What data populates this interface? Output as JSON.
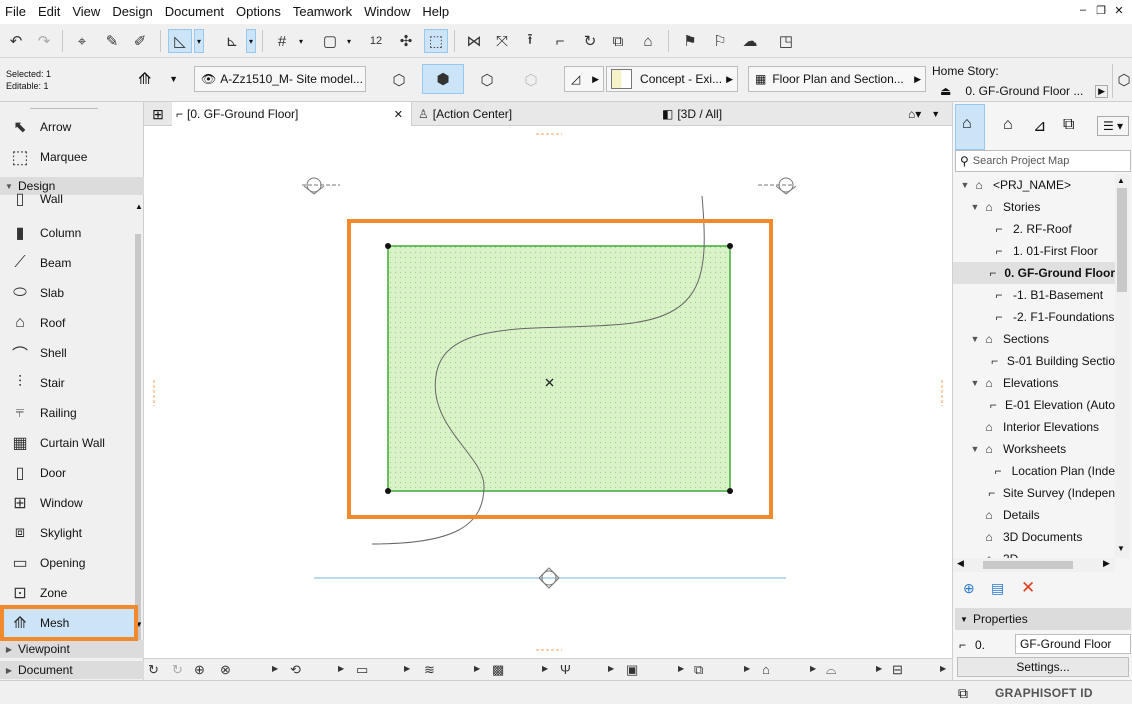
{
  "menu": [
    "File",
    "Edit",
    "View",
    "Design",
    "Document",
    "Options",
    "Teamwork",
    "Window",
    "Help"
  ],
  "window_controls": [
    "–",
    "❐",
    "✕"
  ],
  "info": {
    "selected": "Selected: 1",
    "editable": "Editable: 1"
  },
  "infobox": {
    "layer": "A-Zz1510_M- Site model...",
    "surface": "Concept - Exi...",
    "floor_plan": "Floor Plan and Section...",
    "home_story_label": "Home Story:",
    "home_story_value": "0. GF-Ground Floor ..."
  },
  "toolbox": {
    "pointer_tools": [
      {
        "label": "Arrow",
        "icon": "arrow-icon"
      },
      {
        "label": "Marquee",
        "icon": "marquee-icon"
      }
    ],
    "design_header": "Design",
    "design_tools": [
      {
        "label": "Wall",
        "icon": "wall-icon"
      },
      {
        "label": "Column",
        "icon": "column-icon"
      },
      {
        "label": "Beam",
        "icon": "beam-icon"
      },
      {
        "label": "Slab",
        "icon": "slab-icon"
      },
      {
        "label": "Roof",
        "icon": "roof-icon"
      },
      {
        "label": "Shell",
        "icon": "shell-icon"
      },
      {
        "label": "Stair",
        "icon": "stair-icon"
      },
      {
        "label": "Railing",
        "icon": "railing-icon"
      },
      {
        "label": "Curtain Wall",
        "icon": "curtain-wall-icon"
      },
      {
        "label": "Door",
        "icon": "door-icon"
      },
      {
        "label": "Window",
        "icon": "window-icon"
      },
      {
        "label": "Skylight",
        "icon": "skylight-icon"
      },
      {
        "label": "Opening",
        "icon": "opening-icon"
      },
      {
        "label": "Zone",
        "icon": "zone-icon"
      },
      {
        "label": "Mesh",
        "icon": "mesh-icon",
        "selected": true
      }
    ],
    "viewpoint_header": "Viewpoint",
    "document_header": "Document"
  },
  "tabs": [
    {
      "label": "[0. GF-Ground Floor]",
      "active": true,
      "close": "✕"
    },
    {
      "label": "[Action Center]",
      "active": false
    },
    {
      "label": "[3D / All]",
      "active": false
    }
  ],
  "project_map": {
    "search_placeholder": "Search Project Map",
    "items": [
      {
        "label": "<PRJ_NAME>",
        "level": 0,
        "expanded": true
      },
      {
        "label": "Stories",
        "level": 1,
        "expanded": true
      },
      {
        "label": "2. RF-Roof",
        "level": 2
      },
      {
        "label": "1. 01-First Floor",
        "level": 2
      },
      {
        "label": "0. GF-Ground Floor",
        "level": 2,
        "selected": true
      },
      {
        "label": "-1. B1-Basement",
        "level": 2
      },
      {
        "label": "-2. F1-Foundations",
        "level": 2
      },
      {
        "label": "Sections",
        "level": 1,
        "expanded": true
      },
      {
        "label": "S-01 Building Sectio",
        "level": 2
      },
      {
        "label": "Elevations",
        "level": 1,
        "expanded": true
      },
      {
        "label": "E-01 Elevation (Auto",
        "level": 2
      },
      {
        "label": "Interior Elevations",
        "level": 1
      },
      {
        "label": "Worksheets",
        "level": 1,
        "expanded": true
      },
      {
        "label": "Location Plan (Inde",
        "level": 2
      },
      {
        "label": "Site Survey (Indepen",
        "level": 2
      },
      {
        "label": "Details",
        "level": 1
      },
      {
        "label": "3D Documents",
        "level": 1
      },
      {
        "label": "3D",
        "level": 1
      }
    ]
  },
  "properties": {
    "header": "Properties",
    "story_number": "0.",
    "story_name": "GF-Ground Floor",
    "settings_button": "Settings..."
  },
  "status": {
    "brand": "GRAPHISOFT ID"
  },
  "colors": {
    "selection_highlight": "#f08a2c",
    "mesh_fill": "#d9f2c8",
    "mesh_border": "#3cab3c",
    "tool_selected": "#cce4f7"
  }
}
